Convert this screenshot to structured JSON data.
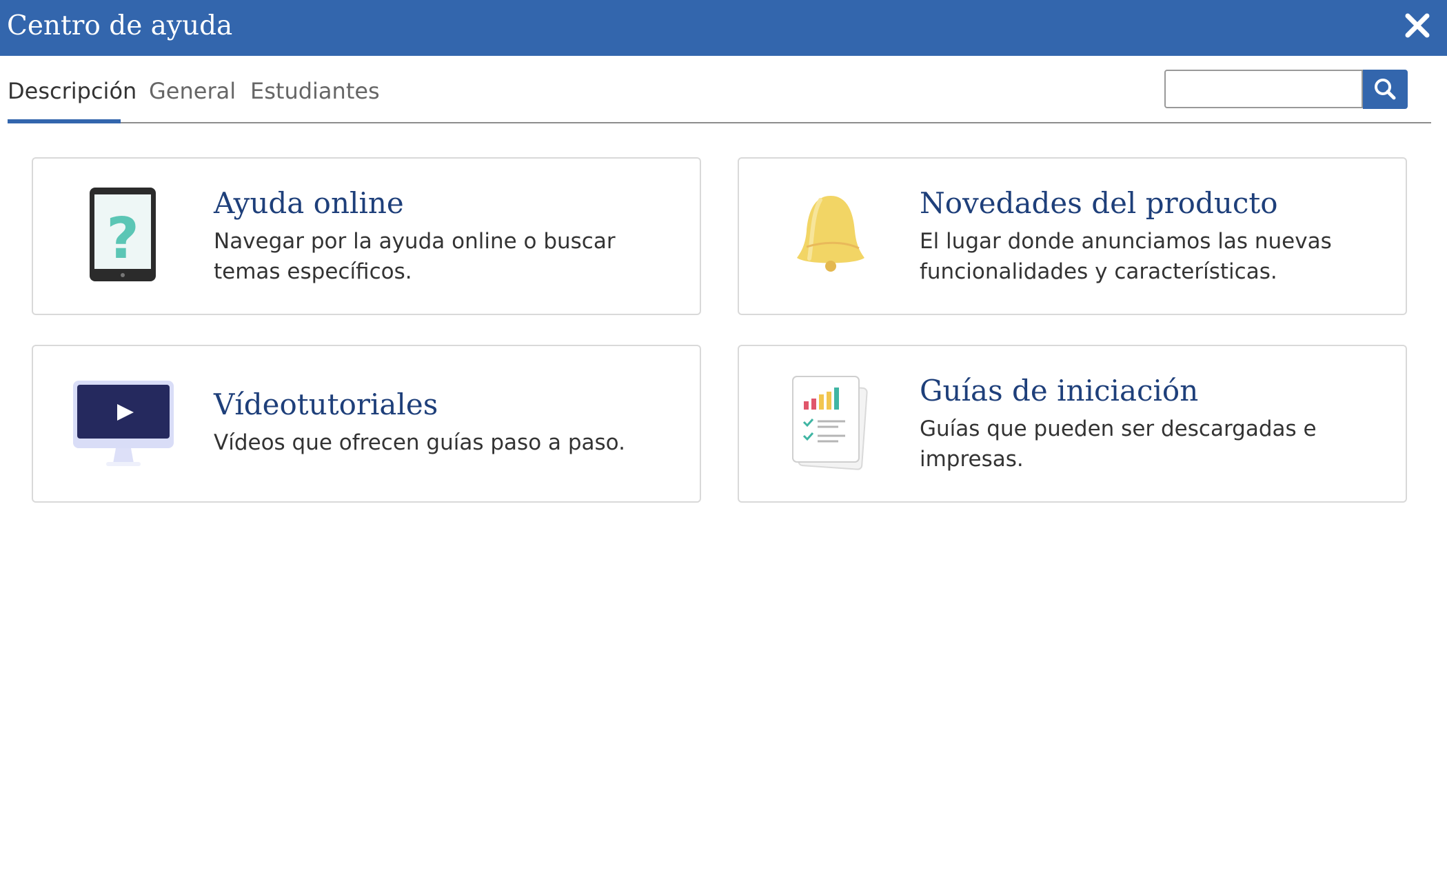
{
  "dialog": {
    "title": "Centro de ayuda",
    "close_icon": "close-icon"
  },
  "tabs": [
    {
      "label": "Descripción",
      "active": true
    },
    {
      "label": "General",
      "active": false
    },
    {
      "label": "Estudiantes",
      "active": false
    }
  ],
  "search": {
    "value": "",
    "placeholder": "",
    "button_icon": "search-icon"
  },
  "cards": [
    {
      "title": "Ayuda online",
      "description": "Navegar por la ayuda online o buscar temas específicos.",
      "icon": "tablet-question-icon"
    },
    {
      "title": "Novedades del producto",
      "description": "El lugar donde anunciamos las nuevas funcionalidades y características.",
      "icon": "bell-icon"
    },
    {
      "title": "Vídeotutoriales",
      "description": "Vídeos que ofrecen guías paso a paso.",
      "icon": "monitor-play-icon"
    },
    {
      "title": "Guías de iniciación",
      "description": "Guías que pueden ser descargadas e impresas.",
      "icon": "document-chart-icon"
    }
  ],
  "colors": {
    "accent": "#3366ad",
    "card_title": "#1e3f7a",
    "bell": "#f2d565",
    "help_mark": "#5bc6b5"
  }
}
